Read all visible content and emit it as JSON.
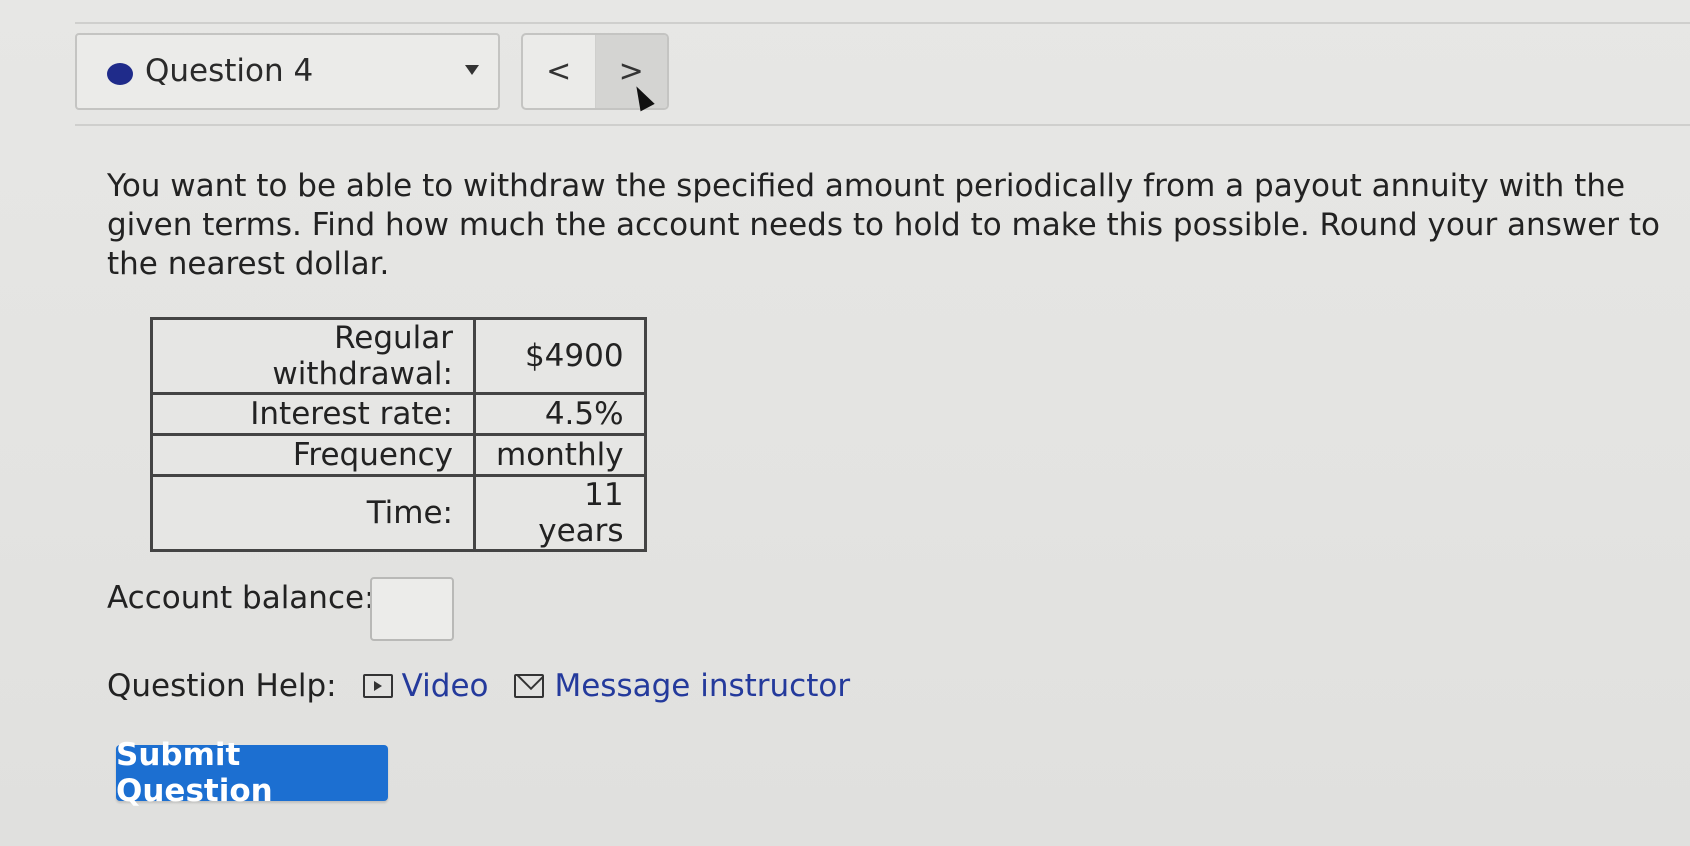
{
  "header": {
    "question_label": "Question 4",
    "prev_label": "<",
    "next_label": ">",
    "status_color": "#1f2b8a"
  },
  "question": {
    "prompt": "You want to be able to withdraw the specified amount periodically from a payout annuity with the given terms. Find how much the account needs to hold to make this possible. Round your answer to the nearest dollar.",
    "table": [
      {
        "label": "Regular withdrawal:",
        "value": "$4900"
      },
      {
        "label": "Interest rate:",
        "value": "4.5%"
      },
      {
        "label": "Frequency",
        "value": "monthly"
      },
      {
        "label": "Time:",
        "value": "11 years"
      }
    ],
    "answer_label": "Account balance: $",
    "answer_value": ""
  },
  "help": {
    "label": "Question Help:",
    "video_label": "Video",
    "message_label": "Message instructor"
  },
  "submit": {
    "label": "Submit Question",
    "color": "#1c6fd1"
  },
  "icons": {
    "status": "status-dot-icon",
    "dropdown": "chevron-down-icon",
    "video": "video-icon",
    "message": "mail-icon"
  }
}
